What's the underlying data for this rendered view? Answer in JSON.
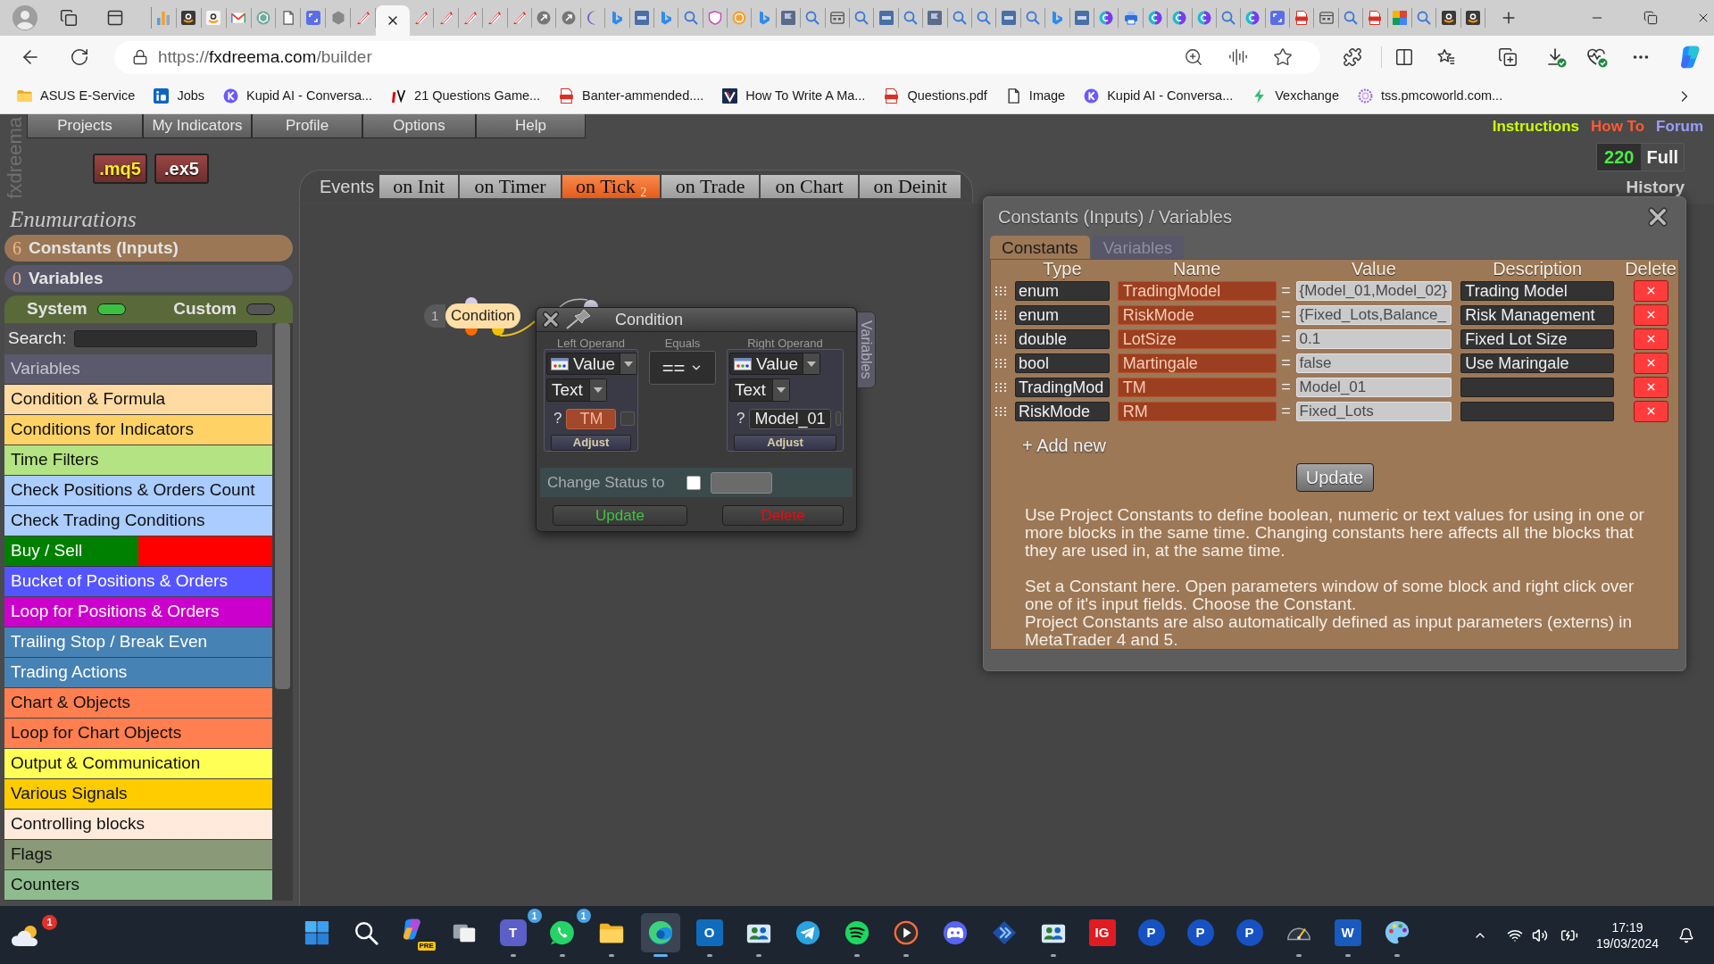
{
  "browser": {
    "tabs": [
      {
        "kind": "chart",
        "selected": false
      },
      {
        "kind": "amazon",
        "selected": false
      },
      {
        "kind": "amazon_light",
        "selected": false
      },
      {
        "kind": "mail",
        "selected": false
      },
      {
        "kind": "knot",
        "selected": false
      },
      {
        "kind": "page",
        "selected": false
      },
      {
        "kind": "expand",
        "selected": false
      },
      {
        "kind": "hexagon",
        "selected": false
      },
      {
        "kind": "feather",
        "selected": false
      },
      {
        "selected": true
      },
      {
        "kind": "feather",
        "selected": false
      },
      {
        "kind": "feather",
        "selected": false
      },
      {
        "kind": "feather",
        "selected": false
      },
      {
        "kind": "feather",
        "selected": false
      },
      {
        "kind": "feather",
        "selected": false
      },
      {
        "kind": "arrow",
        "selected": false
      },
      {
        "kind": "arrow",
        "selected": false
      },
      {
        "kind": "moon",
        "selected": false
      },
      {
        "kind": "bing",
        "selected": false
      },
      {
        "kind": "mql",
        "selected": false
      },
      {
        "kind": "bing",
        "selected": false
      },
      {
        "kind": "search",
        "selected": false
      },
      {
        "kind": "shield",
        "selected": false
      },
      {
        "kind": "coin",
        "selected": false
      },
      {
        "kind": "bing",
        "selected": false
      },
      {
        "kind": "flag",
        "selected": false
      },
      {
        "kind": "search",
        "selected": false
      },
      {
        "kind": "grid",
        "selected": false
      },
      {
        "kind": "search",
        "selected": false
      },
      {
        "kind": "mql",
        "selected": false
      },
      {
        "kind": "search",
        "selected": false
      },
      {
        "kind": "flag",
        "selected": false
      },
      {
        "kind": "search",
        "selected": false
      },
      {
        "kind": "search",
        "selected": false
      },
      {
        "kind": "mql",
        "selected": false
      },
      {
        "kind": "search",
        "selected": false
      },
      {
        "kind": "bing",
        "selected": false
      },
      {
        "kind": "mql",
        "selected": false
      },
      {
        "kind": "canva",
        "selected": false
      },
      {
        "kind": "printer",
        "selected": false
      },
      {
        "kind": "canva",
        "selected": false
      },
      {
        "kind": "canva",
        "selected": false
      },
      {
        "kind": "canva",
        "selected": false
      },
      {
        "kind": "search",
        "selected": false
      },
      {
        "kind": "canva",
        "selected": false
      },
      {
        "kind": "expand",
        "selected": false
      },
      {
        "kind": "pdf",
        "selected": false
      },
      {
        "kind": "grid",
        "selected": false
      },
      {
        "kind": "search",
        "selected": false
      },
      {
        "kind": "pdf",
        "selected": false
      },
      {
        "kind": "two",
        "selected": false
      },
      {
        "kind": "search",
        "selected": false
      },
      {
        "kind": "amazon",
        "selected": false
      },
      {
        "kind": "amazon",
        "selected": false
      }
    ],
    "address": {
      "scheme": "https://",
      "host": "fxdreema.com",
      "path": "/builder"
    },
    "bookmarks": [
      {
        "kind": "folder",
        "label": "ASUS E-Service"
      },
      {
        "kind": "tile_in",
        "label": "Jobs"
      },
      {
        "kind": "k_circle",
        "label": "Kupid AI - Conversa..."
      },
      {
        "kind": "tv",
        "label": "21 Questions Game..."
      },
      {
        "kind": "pdf",
        "label": "Banter-ammended...."
      },
      {
        "kind": "v_tile",
        "label": "How To Write A Ma..."
      },
      {
        "kind": "pdf",
        "label": "Questions.pdf"
      },
      {
        "kind": "page",
        "label": "Image"
      },
      {
        "kind": "k_circle",
        "label": "Kupid AI - Conversa..."
      },
      {
        "kind": "bolt",
        "label": "Vexchange"
      },
      {
        "kind": "ring",
        "label": "tss.pmcoworld.com..."
      }
    ]
  },
  "app": {
    "logo": "fxdreema",
    "menu": [
      {
        "label": "Projects"
      },
      {
        "label": "My Indicators"
      },
      {
        "label": "Profile"
      },
      {
        "label": "Options"
      },
      {
        "label": "Help"
      }
    ],
    "file_buttons": [
      {
        "label": ".mq5",
        "kind": "source"
      },
      {
        "label": ".ex5",
        "kind": "compiled"
      }
    ],
    "links": [
      {
        "label": "Instructions",
        "color": "#ccff00"
      },
      {
        "label": "How To",
        "color": "#ff5a33"
      },
      {
        "label": "Forum",
        "color": "#9c9cff"
      }
    ],
    "counter": {
      "value": "220",
      "label": "Full"
    },
    "history": "History",
    "events": {
      "label": "Events",
      "tabs": [
        {
          "label": "on Init",
          "selected": false
        },
        {
          "label": "on Timer",
          "selected": false
        },
        {
          "label": "on Tick $_{2}$",
          "selected": true
        },
        {
          "label": "on Trade",
          "selected": false
        },
        {
          "label": "on Chart",
          "selected": false
        },
        {
          "label": "on Deinit",
          "selected": false
        }
      ]
    },
    "sidebar": {
      "heading": "Enumurations",
      "sections": [
        {
          "count": "6",
          "label": "Constants (Inputs)",
          "color": "#9b7756"
        },
        {
          "count": "0",
          "label": "Variables",
          "color": "#575769"
        }
      ],
      "toggles": [
        {
          "label": "System",
          "on": true
        },
        {
          "label": "Custom",
          "on": false
        }
      ],
      "search": {
        "label": "Search:"
      },
      "categories": [
        {
          "kind": "header",
          "label": "Variables",
          "color": "#5a5a6c"
        },
        {
          "kind": "category",
          "label": "Condition & Formula",
          "color": "#ffdaa3"
        },
        {
          "kind": "category",
          "label": "Conditions for Indicators",
          "color": "#ffd265"
        },
        {
          "kind": "category",
          "label": "Time Filters",
          "color": "#b3e383"
        },
        {
          "kind": "category",
          "label": "Check Positions & Orders Count",
          "color": "#aaccff"
        },
        {
          "kind": "category",
          "label": "Check Trading Conditions",
          "color": "#aaccff"
        },
        {
          "kind": "split",
          "label": "Buy / Sell",
          "color": "#008000",
          "band": {
            "color": "#ff0000"
          }
        },
        {
          "kind": "category",
          "label": "Bucket of Positions & Orders",
          "color": "#5555ff"
        },
        {
          "kind": "category",
          "label": "Loop for Positions & Orders",
          "color": "#cc00cc"
        },
        {
          "kind": "category",
          "label": "Trailing Stop / Break Even",
          "color": "#4682b4"
        },
        {
          "kind": "category",
          "label": "Trading Actions",
          "color": "#4682b4"
        },
        {
          "kind": "category",
          "label": "Chart & Objects",
          "color": "#ff7f50"
        },
        {
          "kind": "category",
          "label": "Loop for Chart Objects",
          "color": "#ff7f50"
        },
        {
          "kind": "category",
          "label": "Output & Communication",
          "color": "#ffff55"
        },
        {
          "kind": "category",
          "label": "Various Signals",
          "color": "#ffcc00"
        },
        {
          "kind": "category",
          "label": "Controlling blocks",
          "color": "#ffeadb"
        },
        {
          "kind": "category",
          "label": "Flags",
          "color": "#8a9a78"
        },
        {
          "kind": "category",
          "label": "Counters",
          "color": "#8fbc8f"
        }
      ]
    },
    "canvas": {
      "blocks": [
        {
          "number": "1",
          "label": "Condition"
        }
      ]
    },
    "condition_dialog": {
      "title": "Condition",
      "side_tab": "Variables",
      "operands": [
        {
          "heading": "Left Operand",
          "source": "Value",
          "format": "Text",
          "prefix": "?",
          "value": "TM",
          "kind": "constant",
          "checked": false,
          "adjust": "Adjust"
        },
        {
          "heading": "Right Operand",
          "source": "Value",
          "format": "Text",
          "prefix": "?",
          "value": "Model_01",
          "kind": "literal",
          "checked": false,
          "adjust": "Adjust"
        }
      ],
      "comparator": {
        "heading": "Equals",
        "value": "=="
      },
      "status": {
        "label": "Change Status to",
        "checked": false
      },
      "actions": [
        {
          "label": "Update",
          "kind": "update"
        },
        {
          "label": "Delete",
          "kind": "delete"
        }
      ]
    },
    "constants_panel": {
      "title": "Constants (Inputs) / Variables",
      "tabs": [
        {
          "label": "Constants",
          "selected": true
        },
        {
          "label": "Variables",
          "selected": false
        }
      ],
      "columns": [
        "Type",
        "Name",
        "Value",
        "Description",
        "Delete"
      ],
      "rows": [
        {
          "type": "enum",
          "name": "TradingModel",
          "operator": "=",
          "value": "{Model_01,Model_02}",
          "description": "Trading Model"
        },
        {
          "type": "enum",
          "name": "RiskMode",
          "operator": "=",
          "value": "{Fixed_Lots,Balance_",
          "description": "Risk Management"
        },
        {
          "type": "double",
          "name": "LotSize",
          "operator": "=",
          "value": "0.1",
          "description": "Fixed Lot Size"
        },
        {
          "type": "bool",
          "name": "Martingale",
          "operator": "=",
          "value": "false",
          "description": "Use Maringale"
        },
        {
          "type": "TradingMod",
          "name": "TM",
          "operator": "=",
          "value": "Model_01"
        },
        {
          "type": "RiskMode",
          "name": "RM",
          "operator": "=",
          "value": "Fixed_Lots"
        }
      ],
      "add_new": "+ Add new",
      "update": "Update",
      "help": [
        {
          "lines": [
            "Use Project Constants to define boolean, numeric or text values for using in one or more blocks in the same time. Changing constants here affects all the blocks that they are used in, at the same time."
          ]
        },
        {
          "lines": [
            "Set a Constant here. Open parameters window of some block and right click over one of it's input fields. Choose the Constant.",
            "Project Constants are also automatically defined as input parameters (externs) in MetaTrader 4 and 5."
          ]
        }
      ]
    }
  },
  "taskbar": {
    "weather": {
      "badge": "1"
    },
    "apps": [
      {
        "kind": "start",
        "selected": false,
        "running": false
      },
      {
        "kind": "search",
        "selected": false,
        "running": false
      },
      {
        "kind": "copilot",
        "label": "PRE",
        "selected": false,
        "running": false
      },
      {
        "kind": "task_view",
        "selected": false,
        "running": false
      },
      {
        "kind": "teams",
        "label": "T",
        "badge": "1",
        "selected": false,
        "running": true
      },
      {
        "kind": "chat",
        "badge": "1",
        "selected": false,
        "running": true
      },
      {
        "kind": "folder",
        "selected": false,
        "running": true
      },
      {
        "kind": "browser",
        "selected": true,
        "running": true
      },
      {
        "kind": "mail",
        "label": "O",
        "selected": false,
        "running": true
      },
      {
        "kind": "people",
        "selected": false,
        "running": true
      },
      {
        "kind": "plane",
        "selected": false,
        "running": false
      },
      {
        "kind": "music",
        "selected": false,
        "running": true
      },
      {
        "kind": "play",
        "selected": false,
        "running": true
      },
      {
        "kind": "gamepad",
        "selected": false,
        "running": false
      },
      {
        "kind": "chevrons",
        "selected": false,
        "running": false
      },
      {
        "kind": "people",
        "selected": false,
        "running": true
      },
      {
        "kind": "tile",
        "label": "IG",
        "selected": false,
        "running": false
      },
      {
        "kind": "p_tile",
        "label": "P",
        "selected": false,
        "running": false
      },
      {
        "kind": "p_tile",
        "label": "P",
        "selected": false,
        "running": false
      },
      {
        "kind": "p_tile",
        "label": "P",
        "selected": false,
        "running": false
      },
      {
        "kind": "gauge",
        "selected": false,
        "running": true
      },
      {
        "kind": "word",
        "label": "W",
        "selected": false,
        "running": true
      },
      {
        "kind": "palette",
        "selected": false,
        "running": true
      }
    ],
    "clock": {
      "time": "17:19",
      "date": "19/03/2024"
    }
  }
}
